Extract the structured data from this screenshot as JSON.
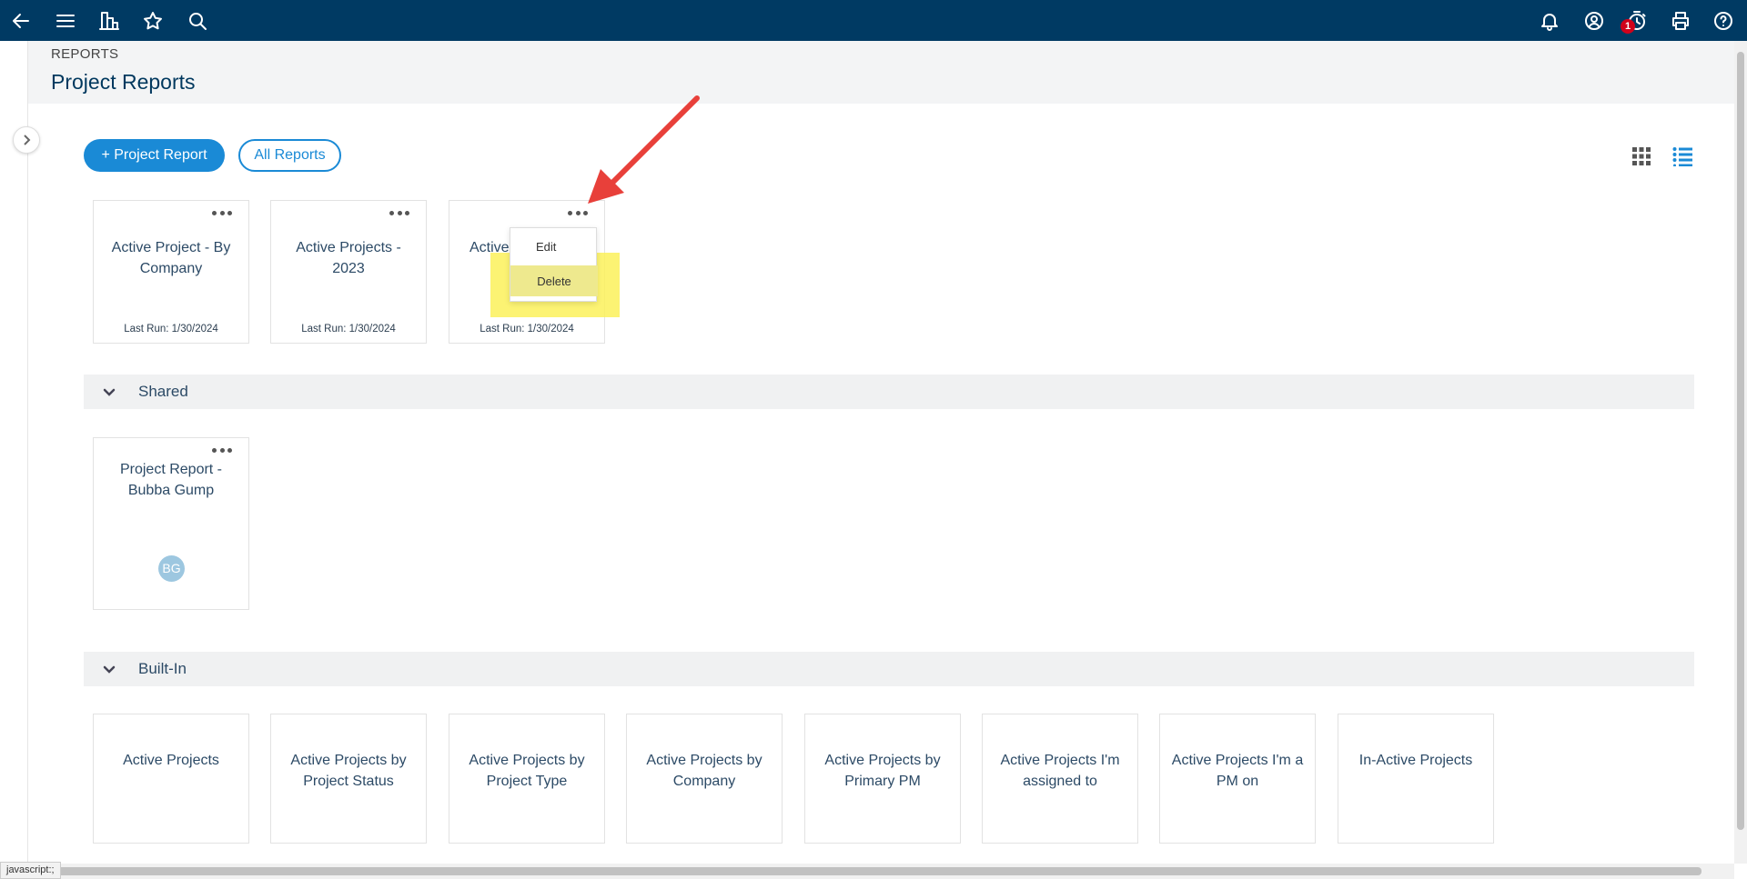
{
  "topbar": {
    "left_icons": [
      "back-arrow-icon",
      "hamburger-menu-icon",
      "org-chart-icon",
      "star-icon",
      "search-icon"
    ],
    "right_icons": [
      "bell-icon",
      "user-circle-icon",
      "timer-icon",
      "printer-icon",
      "help-icon"
    ],
    "timer_badge": "1",
    "bar_color": "#003a63",
    "badge_color": "#d0021b"
  },
  "header": {
    "breadcrumb": "REPORTS",
    "title": "Project Reports"
  },
  "actions": {
    "new_report": "+ Project Report",
    "all_reports": "All Reports",
    "accent": "#1a8ad6"
  },
  "my_reports": [
    {
      "title": "Active Project - By Company",
      "last_run": "Last Run: 1/30/2024"
    },
    {
      "title": "Active Projects - 2023",
      "last_run": "Last Run: 1/30/2024"
    },
    {
      "title": "Active",
      "last_run": "Last Run: 1/30/2024"
    }
  ],
  "context_menu": {
    "edit": "Edit",
    "delete": "Delete"
  },
  "shared": {
    "label": "Shared",
    "reports": [
      {
        "title": "Project Report - Bubba Gump",
        "avatar": "BG"
      }
    ]
  },
  "builtin": {
    "label": "Built-In",
    "reports": [
      {
        "title": "Active Projects"
      },
      {
        "title": "Active Projects by Project Status"
      },
      {
        "title": "Active Projects by Project Type"
      },
      {
        "title": "Active Projects by Company"
      },
      {
        "title": "Active Projects by Primary PM"
      },
      {
        "title": "Active Projects I'm assigned to"
      },
      {
        "title": "Active Projects I'm a PM on"
      },
      {
        "title": "In-Active Projects"
      }
    ]
  },
  "status_bar": "javascript:;"
}
